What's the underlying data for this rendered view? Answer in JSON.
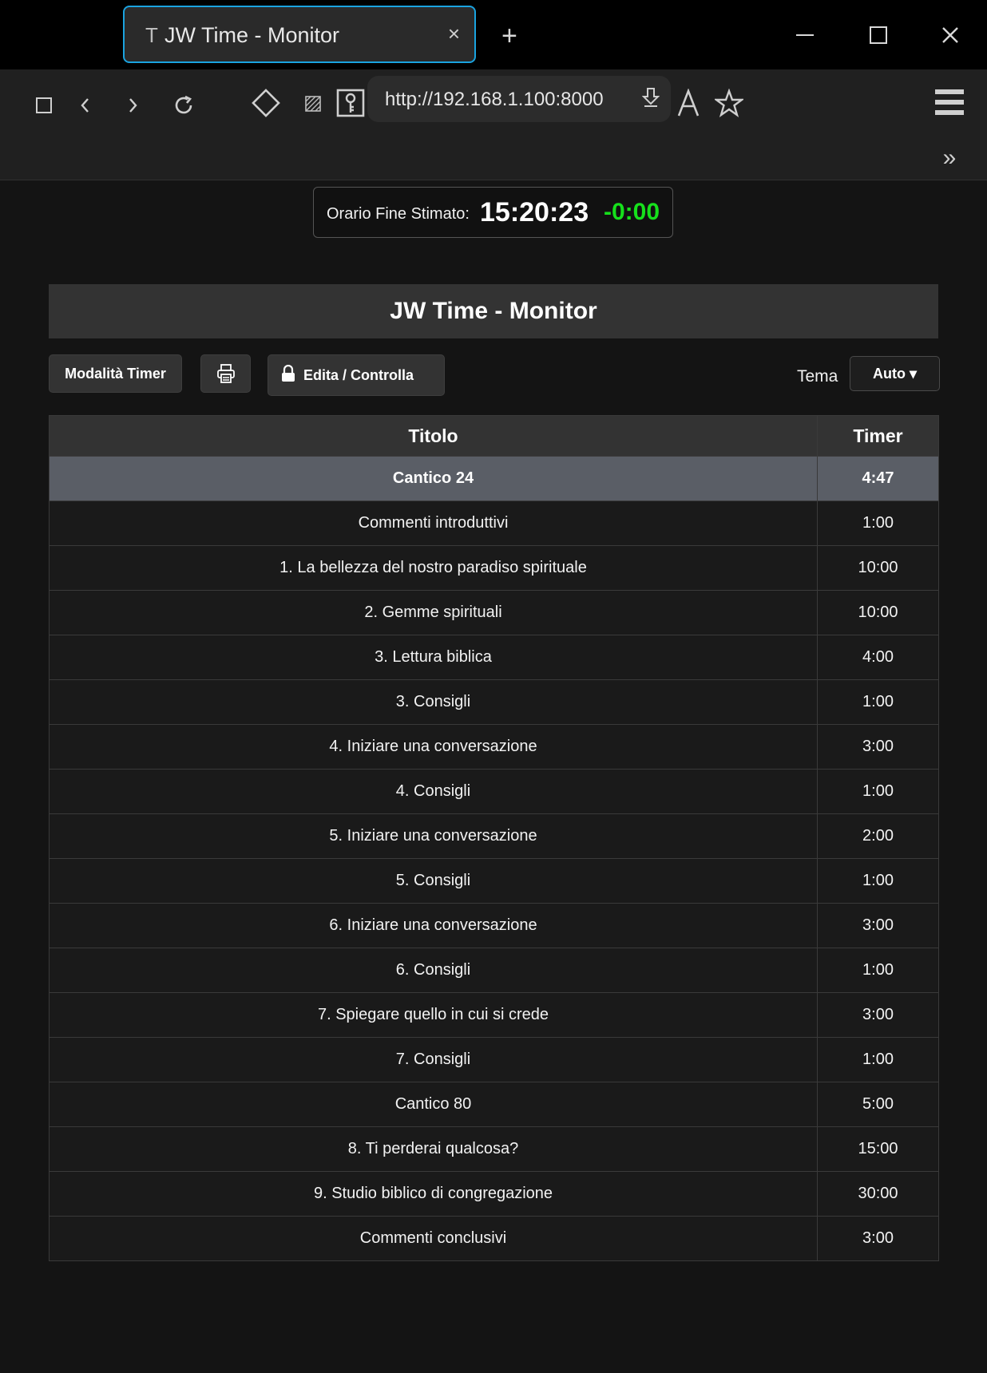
{
  "browser": {
    "tab_favicon": "T",
    "tab_title": "JW Time - Monitor",
    "tab_close": "×",
    "new_tab": "+",
    "url": "http://192.168.1.100:8000",
    "overflow": "»"
  },
  "end_time": {
    "label": "Orario Fine Stimato:",
    "time": "15:20:23",
    "delta": "-0:00",
    "delta_color": "#16e01c"
  },
  "page": {
    "title": "JW Time - Monitor"
  },
  "controls": {
    "timer_mode_label": "Modalità Timer",
    "edit_label": "Edita / Controlla",
    "theme_label": "Tema",
    "theme_value": "Auto ▾"
  },
  "table": {
    "headers": {
      "title": "Titolo",
      "timer": "Timer"
    },
    "rows": [
      {
        "title": "Cantico 24",
        "timer": "4:47",
        "active": true
      },
      {
        "title": "Commenti introduttivi",
        "timer": "1:00"
      },
      {
        "title": "1. La bellezza del nostro paradiso spirituale",
        "timer": "10:00"
      },
      {
        "title": "2. Gemme spirituali",
        "timer": "10:00"
      },
      {
        "title": "3. Lettura biblica",
        "timer": "4:00"
      },
      {
        "title": "3. Consigli",
        "timer": "1:00"
      },
      {
        "title": "4. Iniziare una conversazione",
        "timer": "3:00"
      },
      {
        "title": "4. Consigli",
        "timer": "1:00"
      },
      {
        "title": "5. Iniziare una conversazione",
        "timer": "2:00"
      },
      {
        "title": "5. Consigli",
        "timer": "1:00"
      },
      {
        "title": "6. Iniziare una conversazione",
        "timer": "3:00"
      },
      {
        "title": "6. Consigli",
        "timer": "1:00"
      },
      {
        "title": "7. Spiegare quello in cui si crede",
        "timer": "3:00"
      },
      {
        "title": "7. Consigli",
        "timer": "1:00"
      },
      {
        "title": "Cantico 80",
        "timer": "5:00"
      },
      {
        "title": "8. Ti perderai qualcosa?",
        "timer": "15:00"
      },
      {
        "title": "9. Studio biblico di congregazione",
        "timer": "30:00"
      },
      {
        "title": "Commenti conclusivi",
        "timer": "3:00"
      }
    ]
  }
}
